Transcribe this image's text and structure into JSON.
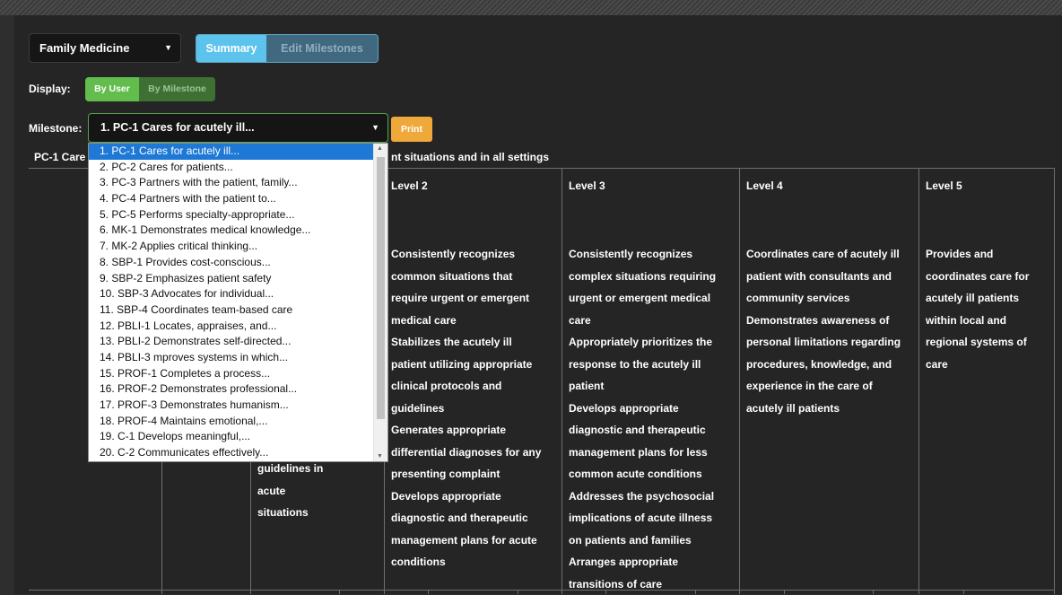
{
  "specialty": {
    "value": "Family Medicine"
  },
  "view_tabs": {
    "summary": "Summary",
    "edit": "Edit Milestones"
  },
  "display": {
    "label": "Display:",
    "by_user": "By User",
    "by_milestone": "By Milestone"
  },
  "milestone": {
    "label": "Milestone:",
    "selected": "1. PC-1 Cares for acutely ill...",
    "options": [
      "1. PC-1 Cares for acutely ill...",
      "2. PC-2 Cares for patients...",
      "3. PC-3 Partners with the patient, family...",
      "4. PC-4 Partners with the patient to...",
      "5. PC-5 Performs specialty-appropriate...",
      "6. MK-1 Demonstrates medical knowledge...",
      "7. MK-2 Applies critical thinking...",
      "8. SBP-1 Provides cost-conscious...",
      "9. SBP-2 Emphasizes patient safety",
      "10. SBP-3 Advocates for individual...",
      "11. SBP-4 Coordinates team-based care",
      "12. PBLI-1 Locates, appraises, and...",
      "13. PBLI-2 Demonstrates self-directed...",
      "14. PBLI-3 mproves systems in which...",
      "15. PROF-1 Completes a process...",
      "16. PROF-2 Demonstrates professional...",
      "17. PROF-3 Demonstrates humanism...",
      "18. PROF-4 Maintains emotional,...",
      "19. C-1 Develops meaningful,...",
      "20. C-2 Communicates effectively..."
    ]
  },
  "print_label": "Print",
  "milestone_title": {
    "left": "PC-1 Care",
    "right": "nt situations and in all settings"
  },
  "levels": {
    "level1_visible": [
      "guidelines in acute",
      "situations"
    ],
    "level2": {
      "title": "Level 2",
      "lines": [
        "Consistently recognizes",
        "common situations that",
        "require urgent or emergent",
        "medical care",
        "Stabilizes the acutely ill",
        "patient utilizing appropriate",
        "clinical protocols and",
        "guidelines",
        "Generates appropriate",
        "differential diagnoses for any",
        "presenting complaint",
        "Develops appropriate",
        "diagnostic and therapeutic",
        "management plans for acute",
        "conditions"
      ]
    },
    "level3": {
      "title": "Level 3",
      "lines": [
        "Consistently recognizes",
        "complex situations requiring",
        "urgent or emergent medical",
        "care",
        "Appropriately prioritizes the",
        "response to the acutely ill",
        "patient",
        "Develops appropriate",
        "diagnostic and therapeutic",
        "management plans for less",
        "common acute conditions",
        "Addresses the psychosocial",
        "implications of acute illness",
        "on patients and families",
        "Arranges appropriate",
        "transitions of care"
      ]
    },
    "level4": {
      "title": "Level 4",
      "lines": [
        "Coordinates care of acutely ill",
        "patient with consultants and",
        "community services",
        "Demonstrates awareness of",
        "personal limitations regarding",
        "procedures, knowledge, and",
        "experience in the care of",
        "acutely ill patients"
      ]
    },
    "level5": {
      "title": "Level 5",
      "lines": [
        "Provides and",
        "coordinates care for",
        "acutely ill patients",
        "within local and",
        "regional systems of",
        "care"
      ]
    }
  }
}
